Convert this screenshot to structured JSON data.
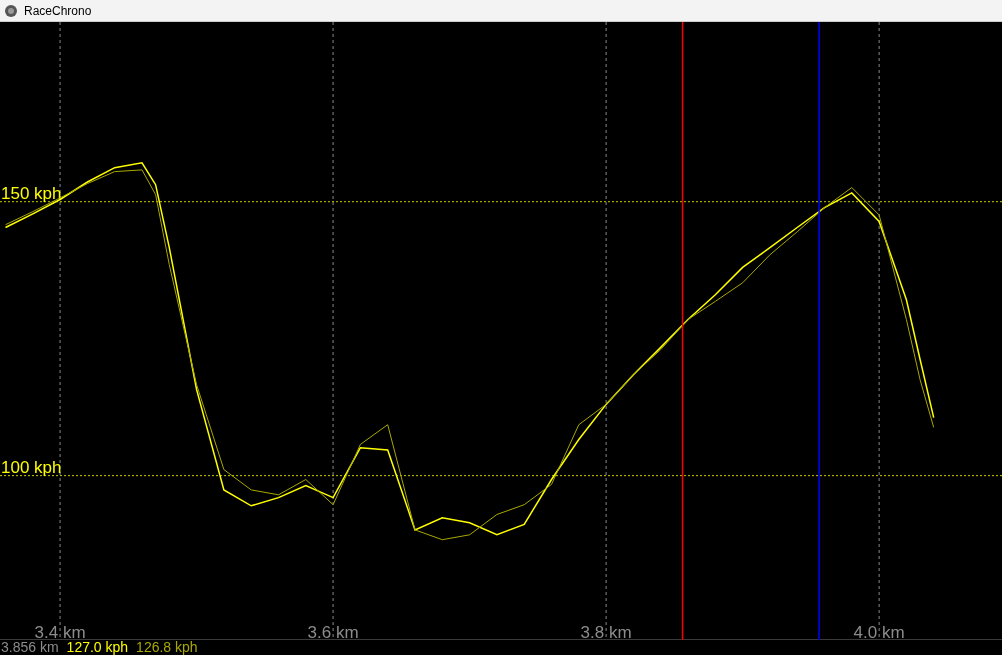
{
  "window": {
    "title": "RaceChrono"
  },
  "chart": {
    "chart_data": {
      "type": "line",
      "x": [
        3.36,
        3.38,
        3.4,
        3.42,
        3.44,
        3.46,
        3.47,
        3.48,
        3.5,
        3.52,
        3.54,
        3.56,
        3.58,
        3.6,
        3.62,
        3.64,
        3.66,
        3.68,
        3.7,
        3.72,
        3.74,
        3.76,
        3.78,
        3.8,
        3.82,
        3.84,
        3.86,
        3.88,
        3.9,
        3.92,
        3.94,
        3.96,
        3.98,
        4.0,
        4.02,
        4.03,
        4.04
      ],
      "series": [
        {
          "color": "#ffff00",
          "values": [
            145.3,
            147.8,
            150.4,
            153.6,
            156.2,
            157.1,
            153.1,
            141.6,
            115.7,
            97.4,
            94.5,
            96.0,
            98.2,
            96.0,
            105.1,
            104.7,
            90.1,
            92.3,
            91.4,
            89.2,
            91.1,
            99.3,
            106.6,
            113.0,
            118.4,
            123.4,
            128.5,
            133.0,
            138.0,
            141.6,
            145.3,
            148.9,
            151.6,
            146.4,
            132.1,
            121.2,
            110.6
          ]
        },
        {
          "color": "#a8a800",
          "values": [
            145.8,
            148.2,
            150.7,
            153.3,
            155.5,
            155.8,
            151.3,
            138.5,
            116.6,
            101.1,
            97.4,
            96.5,
            99.3,
            94.7,
            105.7,
            109.3,
            90.1,
            88.3,
            89.2,
            92.9,
            94.7,
            98.4,
            109.3,
            113.0,
            118.4,
            123.0,
            128.5,
            131.8,
            135.2,
            140.3,
            144.5,
            148.9,
            152.6,
            147.6,
            128.5,
            117.5,
            108.8
          ]
        }
      ],
      "grid": true,
      "xlim": [
        3.356,
        4.09
      ],
      "ylim": [
        70.0,
        182.8
      ],
      "xticks": [
        {
          "value": 3.4,
          "label": "3.4 km"
        },
        {
          "value": 3.6,
          "label": "3.6 km"
        },
        {
          "value": 3.8,
          "label": "3.8 km"
        },
        {
          "value": 4.0,
          "label": "4.0 km"
        }
      ],
      "yticks": [
        {
          "value": 100,
          "label": "100 kph"
        },
        {
          "value": 150,
          "label": "150 kph"
        }
      ],
      "ref_lines": [
        {
          "axis": "x",
          "value": 3.856,
          "color": "#ff0000"
        },
        {
          "axis": "x",
          "value": 3.956,
          "color": "#0000ff"
        }
      ]
    }
  },
  "readout": [
    {
      "text": "3.856 km",
      "color": "#8c8c8c"
    },
    {
      "text": "127.0 kph",
      "color": "#ffff00"
    },
    {
      "text": "126.8 kph",
      "color": "#a8a800"
    }
  ]
}
